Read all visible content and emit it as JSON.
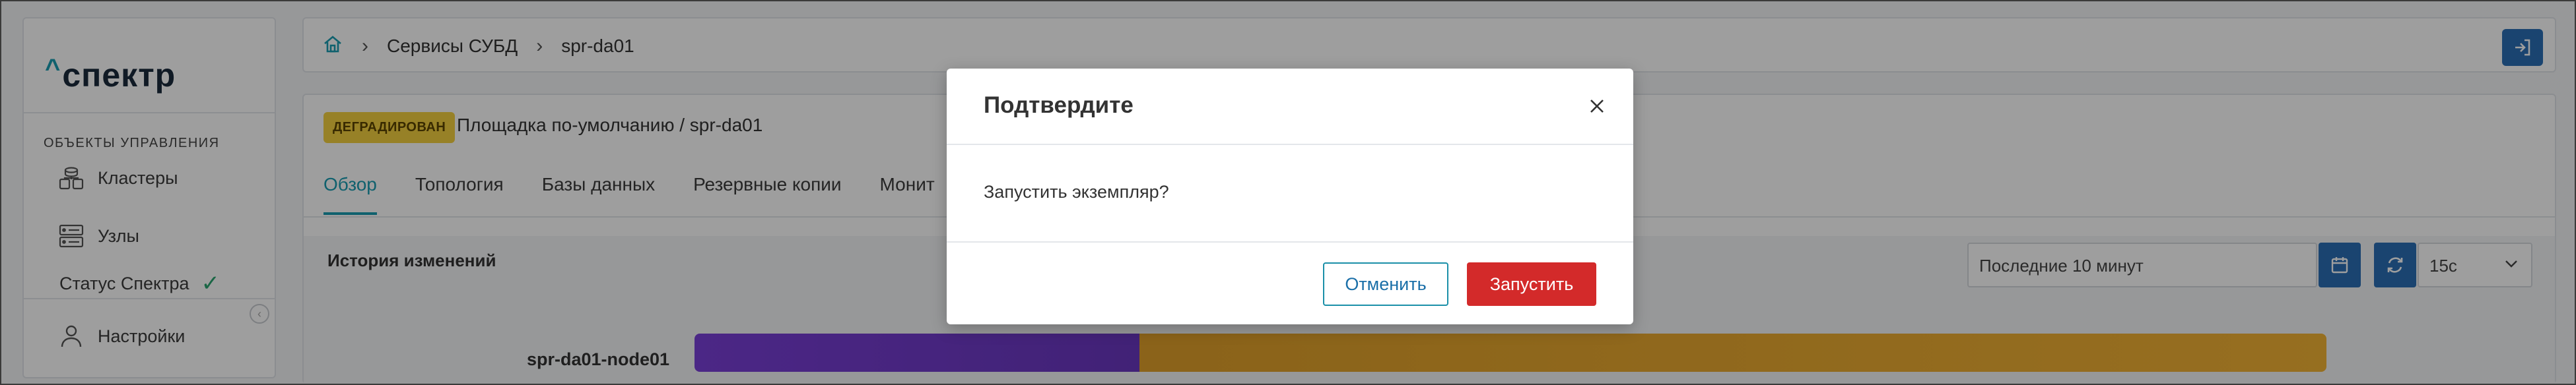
{
  "sidebar": {
    "logo": "спектр",
    "section_title": "ОБЪЕКТЫ УПРАВЛЕНИЯ",
    "items": [
      {
        "label": "Кластеры",
        "icon": "clusters-icon"
      },
      {
        "label": "Узлы",
        "icon": "nodes-icon"
      }
    ],
    "status_label": "Статус Спектра",
    "status_icon": "check-icon",
    "settings_label": "Настройки",
    "settings_icon": "user-icon"
  },
  "breadcrumb": {
    "home_icon": "home-icon",
    "items": [
      "Сервисы СУБД",
      "spr-da01"
    ],
    "exit_icon": "exit-icon"
  },
  "page": {
    "status_badge": "ДЕГРАДИРОВАН",
    "title": "Площадка по-умолчанию /  spr-da01",
    "tabs": [
      "Обзор",
      "Топология",
      "Базы данных",
      "Резервные копии",
      "Монит"
    ],
    "active_tab": "Обзор"
  },
  "history": {
    "title": "История изменений",
    "time_range": "Последние 10 минут",
    "interval": "15с",
    "node": "spr-da01-node01",
    "segments": [
      {
        "state": "purple",
        "color": "#6a37c0",
        "fraction": 0.27
      },
      {
        "state": "orange",
        "color": "#f3b335",
        "fraction": 0.73
      }
    ]
  },
  "modal": {
    "title": "Подтвердите",
    "message": "Запустить экземпляр?",
    "cancel_label": "Отменить",
    "confirm_label": "Запустить"
  },
  "colors": {
    "accent": "#1a9db2",
    "primary_button": "#2a6fb5",
    "danger": "#d32a2a",
    "badge": "#f4d03f"
  }
}
